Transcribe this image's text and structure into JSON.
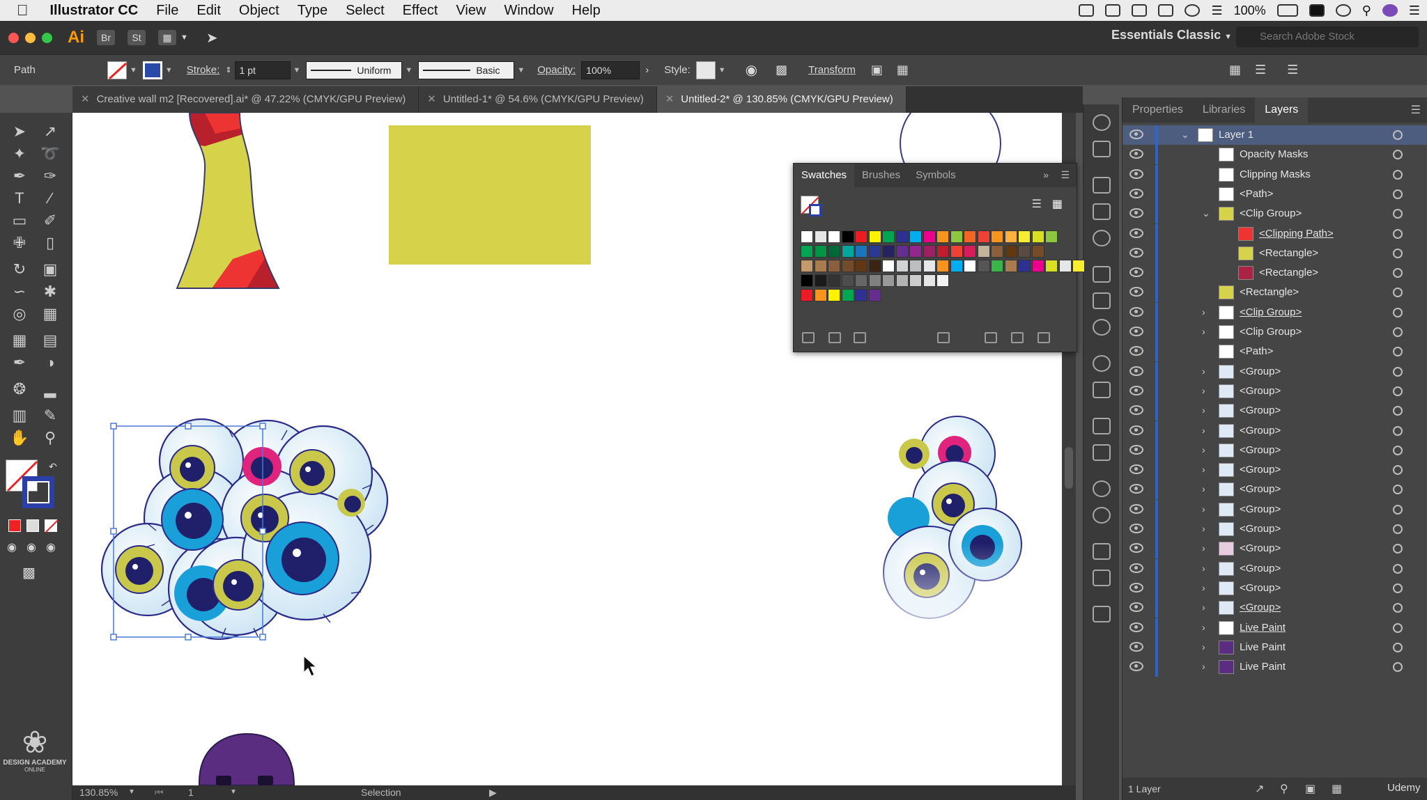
{
  "menubar": {
    "app": "Illustrator CC",
    "items": [
      "File",
      "Edit",
      "Object",
      "Type",
      "Select",
      "Effect",
      "View",
      "Window",
      "Help"
    ],
    "battery": "100%"
  },
  "apptoolbar": {
    "app_badge": "Ai",
    "bridge": "Br",
    "stock": "St",
    "workspace": "Essentials Classic",
    "search_placeholder": "Search Adobe Stock"
  },
  "controlbar": {
    "selection_type": "Path",
    "stroke_label": "Stroke:",
    "stroke_weight": "1 pt",
    "profile": "Uniform",
    "brush": "Basic",
    "opacity_label": "Opacity:",
    "opacity": "100%",
    "style_label": "Style:",
    "transform": "Transform"
  },
  "tabs": [
    {
      "label": "Creative wall m2 [Recovered].ai* @ 47.22% (CMYK/GPU Preview)",
      "active": false
    },
    {
      "label": "Untitled-1* @ 54.6% (CMYK/GPU Preview)",
      "active": false
    },
    {
      "label": "Untitled-2* @ 130.85% (CMYK/GPU Preview)",
      "active": true
    }
  ],
  "status": {
    "zoom": "130.85%",
    "artboard": "1",
    "tool": "Selection"
  },
  "tools_footer": {
    "brand": "DESIGN ACADEMY",
    "brand_sub": "ONLINE"
  },
  "panel_tabs": [
    "Properties",
    "Libraries",
    "Layers"
  ],
  "swatch_tabs": [
    "Swatches",
    "Brushes",
    "Symbols"
  ],
  "swatch_rows": [
    [
      "#ffffff",
      "#e6e6e6",
      "#ffffff",
      "#000000",
      "#ed1c24",
      "#fff200",
      "#00a651",
      "#2e3192",
      "#00aeef",
      "#ec008c",
      "#f7941d",
      "#8dc63f",
      "#f26522",
      "#ef4136",
      "#f7941d",
      "#fbb040",
      "#f9ed32",
      "#d7df23",
      "#8dc63f"
    ],
    [
      "#00a651",
      "#009444",
      "#006838",
      "#00a79d",
      "#1c75bc",
      "#2b3990",
      "#262262",
      "#662d91",
      "#92278f",
      "#9e1f63",
      "#be1e2d",
      "#ef4136",
      "#da1c5c",
      "#c2b59b",
      "#8b5e3c",
      "#603913",
      "#594a42",
      "#754c29"
    ],
    [
      "#c49a6c",
      "#a97c50",
      "#8b5e3c",
      "#754c29",
      "#603913",
      "#3c2415",
      "#ffffff",
      "#d1d3d4",
      "#bcbec0",
      "#e6e7e8",
      "#f7941d",
      "#00aeef",
      "#ffffff",
      "#555555",
      "#39b54a",
      "#a97c50",
      "#2e3192",
      "#ec008c",
      "#d9e021",
      "#e6e7e8",
      "#f9ed32"
    ],
    [
      "#000000",
      "#1a1a1a",
      "#333333",
      "#4d4d4d",
      "#666666",
      "#808080",
      "#999999",
      "#b3b3b3",
      "#cccccc",
      "#e6e6e6",
      "#f2f2f2"
    ],
    [
      "#ed1c24",
      "#f7941d",
      "#fff200",
      "#00a651",
      "#2e3192",
      "#662d91"
    ]
  ],
  "layers": [
    {
      "name": "Layer 1",
      "depth": 0,
      "expand": "v",
      "thumb": "#ffffff",
      "selected": true
    },
    {
      "name": "Opacity Masks",
      "depth": 2,
      "expand": "",
      "thumb": "#ffffff"
    },
    {
      "name": "Clipping Masks",
      "depth": 2,
      "expand": "",
      "thumb": "#ffffff"
    },
    {
      "name": "<Path>",
      "depth": 2,
      "expand": "",
      "thumb": "#ffffff"
    },
    {
      "name": "<Clip Group>",
      "depth": 2,
      "expand": "v",
      "thumb": "#d6d24a"
    },
    {
      "name": "<Clipping Path>",
      "depth": 3,
      "expand": "",
      "thumb": "#ee3333",
      "underline": true
    },
    {
      "name": "<Rectangle>",
      "depth": 3,
      "expand": "",
      "thumb": "#d6d24a"
    },
    {
      "name": "<Rectangle>",
      "depth": 3,
      "expand": "",
      "thumb": "#aa2244"
    },
    {
      "name": "<Rectangle>",
      "depth": 2,
      "expand": "",
      "thumb": "#d6d24a"
    },
    {
      "name": "<Clip Group>",
      "depth": 2,
      "expand": ">",
      "thumb": "#ffffff",
      "underline": true
    },
    {
      "name": "<Clip Group>",
      "depth": 2,
      "expand": ">",
      "thumb": "#ffffff"
    },
    {
      "name": "<Path>",
      "depth": 2,
      "expand": "",
      "thumb": "#ffffff"
    },
    {
      "name": "<Group>",
      "depth": 2,
      "expand": ">",
      "thumb": "#dfe8f5"
    },
    {
      "name": "<Group>",
      "depth": 2,
      "expand": ">",
      "thumb": "#dfe8f5"
    },
    {
      "name": "<Group>",
      "depth": 2,
      "expand": ">",
      "thumb": "#dfe8f5"
    },
    {
      "name": "<Group>",
      "depth": 2,
      "expand": ">",
      "thumb": "#dfe8f5"
    },
    {
      "name": "<Group>",
      "depth": 2,
      "expand": ">",
      "thumb": "#dfe8f5"
    },
    {
      "name": "<Group>",
      "depth": 2,
      "expand": ">",
      "thumb": "#dfe8f5"
    },
    {
      "name": "<Group>",
      "depth": 2,
      "expand": ">",
      "thumb": "#dfe8f5"
    },
    {
      "name": "<Group>",
      "depth": 2,
      "expand": ">",
      "thumb": "#dfe8f5"
    },
    {
      "name": "<Group>",
      "depth": 2,
      "expand": ">",
      "thumb": "#dfe8f5"
    },
    {
      "name": "<Group>",
      "depth": 2,
      "expand": ">",
      "thumb": "#e8cce0"
    },
    {
      "name": "<Group>",
      "depth": 2,
      "expand": ">",
      "thumb": "#dfe8f5"
    },
    {
      "name": "<Group>",
      "depth": 2,
      "expand": ">",
      "thumb": "#dfe8f5"
    },
    {
      "name": "<Group>",
      "depth": 2,
      "expand": ">",
      "thumb": "#dfe8f5",
      "underline": true
    },
    {
      "name": "Live Paint",
      "depth": 2,
      "expand": ">",
      "thumb": "#ffffff",
      "underline": true
    },
    {
      "name": "Live Paint",
      "depth": 2,
      "expand": ">",
      "thumb": "#5b2d80"
    },
    {
      "name": "Live Paint",
      "depth": 2,
      "expand": ">",
      "thumb": "#5b2d80"
    }
  ],
  "layers_footer": {
    "count": "1 Layer",
    "brand": "Udemy"
  },
  "colors": {
    "accent": "#4d5d80",
    "yellow": "#d6d24a",
    "red": "#ee3333",
    "eye_blue": "#2a2a8a",
    "iris_cyan": "#1aa0d8",
    "iris_yellow": "#c9c84a",
    "purple": "#5b2d80"
  }
}
